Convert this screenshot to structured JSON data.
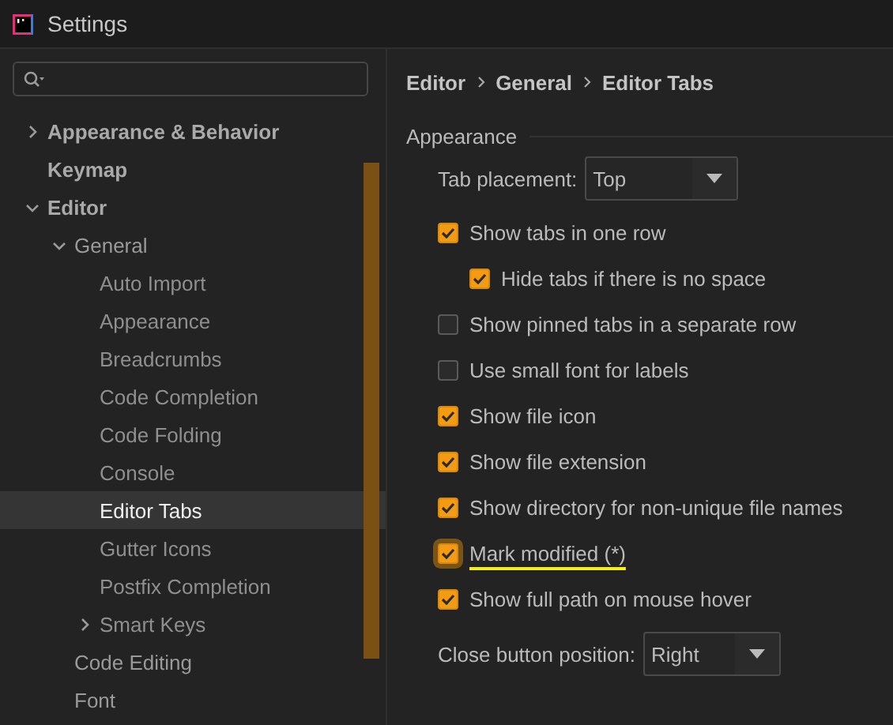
{
  "window": {
    "title": "Settings"
  },
  "sidebar": {
    "items": [
      {
        "label": "Appearance & Behavior",
        "expanded": false,
        "selected": false
      },
      {
        "label": "Keymap",
        "selected": false
      },
      {
        "label": "Editor",
        "expanded": true,
        "selected": false,
        "children": [
          {
            "label": "General",
            "expanded": true,
            "selected": false,
            "children": [
              {
                "label": "Auto Import",
                "selected": false
              },
              {
                "label": "Appearance",
                "selected": false
              },
              {
                "label": "Breadcrumbs",
                "selected": false
              },
              {
                "label": "Code Completion",
                "selected": false
              },
              {
                "label": "Code Folding",
                "selected": false
              },
              {
                "label": "Console",
                "selected": false
              },
              {
                "label": "Editor Tabs",
                "selected": true
              },
              {
                "label": "Gutter Icons",
                "selected": false
              },
              {
                "label": "Postfix Completion",
                "selected": false
              },
              {
                "label": "Smart Keys",
                "expanded": false,
                "selected": false
              }
            ]
          },
          {
            "label": "Code Editing",
            "selected": false
          },
          {
            "label": "Font",
            "selected": false
          }
        ]
      }
    ]
  },
  "breadcrumb": [
    "Editor",
    "General",
    "Editor Tabs"
  ],
  "section": {
    "title": "Appearance"
  },
  "options": [
    {
      "kind": "dropdown",
      "label": "Tab placement:",
      "value": "Top"
    },
    {
      "kind": "checkbox",
      "label": "Show tabs in one row",
      "checked": true,
      "focused": false,
      "underlined": false,
      "children": [
        {
          "kind": "checkbox",
          "label": "Hide tabs if there is no space",
          "checked": true,
          "focused": false,
          "underlined": false
        }
      ]
    },
    {
      "kind": "checkbox",
      "label": "Show pinned tabs in a separate row",
      "checked": false,
      "focused": false,
      "underlined": false
    },
    {
      "kind": "checkbox",
      "label": "Use small font for labels",
      "checked": false,
      "focused": false,
      "underlined": false
    },
    {
      "kind": "checkbox",
      "label": "Show file icon",
      "checked": true,
      "focused": false,
      "underlined": false
    },
    {
      "kind": "checkbox",
      "label": "Show file extension",
      "checked": true,
      "focused": false,
      "underlined": false
    },
    {
      "kind": "checkbox",
      "label": "Show directory for non-unique file names",
      "checked": true,
      "focused": false,
      "underlined": false
    },
    {
      "kind": "checkbox",
      "label": "Mark modified (*)",
      "checked": true,
      "focused": true,
      "underlined": true
    },
    {
      "kind": "checkbox",
      "label": "Show full path on mouse hover",
      "checked": true,
      "focused": false,
      "underlined": false
    },
    {
      "kind": "dropdown",
      "label": "Close button position:",
      "value": "Right"
    }
  ]
}
